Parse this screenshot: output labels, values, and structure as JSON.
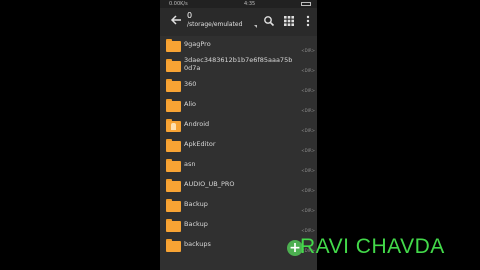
{
  "status_bar": {
    "left": "0.00K/s",
    "time": "4:35"
  },
  "toolbar": {
    "count": "0",
    "path": "/storage/emulated",
    "back_icon": "arrow-left-icon",
    "search_icon": "search-icon",
    "grid_icon": "grid-view-icon",
    "menu_icon": "more-vertical-icon"
  },
  "colors": {
    "folder": "#f7a334",
    "fab": "#4caf50",
    "watermark": "#43d94a",
    "background": "#303030"
  },
  "files": [
    {
      "name": "9gagPro",
      "kind": "<DIR>"
    },
    {
      "name": "3daec3483612b1b7e6f85aaa75b0d7a",
      "kind": "<DIR>"
    },
    {
      "name": "360",
      "kind": "<DIR>"
    },
    {
      "name": "Alio",
      "kind": "<DIR>"
    },
    {
      "name": "Android",
      "kind": "<DIR>",
      "android": true
    },
    {
      "name": "ApkEditor",
      "kind": "<DIR>"
    },
    {
      "name": "asn",
      "kind": "<DIR>"
    },
    {
      "name": "AUDIO_UB_PRO",
      "kind": "<DIR>"
    },
    {
      "name": "Backup",
      "kind": "<DIR>"
    },
    {
      "name": "Backup",
      "kind": "<DIR>"
    },
    {
      "name": "backups",
      "kind": "<DIR>"
    }
  ],
  "fab_label": "+",
  "watermark": "RAVI CHAVDA"
}
